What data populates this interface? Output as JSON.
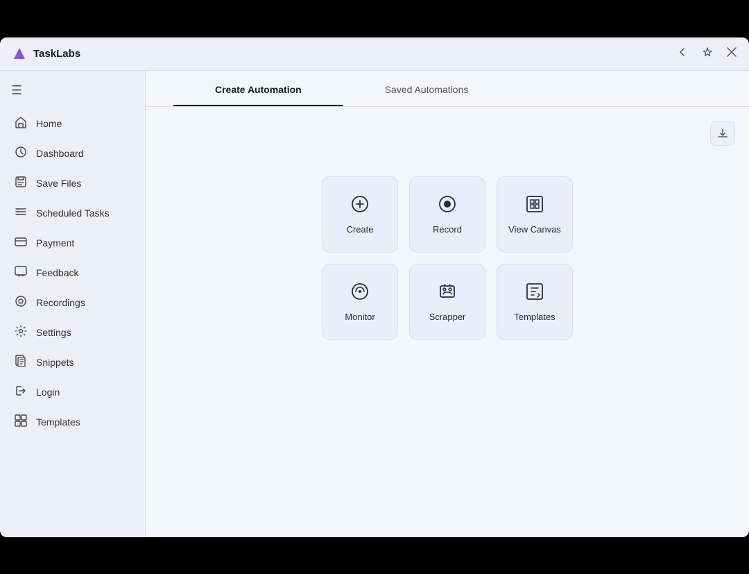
{
  "app": {
    "title": "TaskLabs",
    "logo_color": "#6c3fc5"
  },
  "titlebar": {
    "back_label": "↩",
    "pin_label": "⊳",
    "close_label": "✕"
  },
  "sidebar": {
    "menu_icon": "☰",
    "items": [
      {
        "id": "home",
        "label": "Home",
        "icon": "home"
      },
      {
        "id": "dashboard",
        "label": "Dashboard",
        "icon": "dashboard"
      },
      {
        "id": "save-files",
        "label": "Save Files",
        "icon": "save-files"
      },
      {
        "id": "scheduled-tasks",
        "label": "Scheduled Tasks",
        "icon": "scheduled-tasks"
      },
      {
        "id": "payment",
        "label": "Payment",
        "icon": "payment"
      },
      {
        "id": "feedback",
        "label": "Feedback",
        "icon": "feedback"
      },
      {
        "id": "recordings",
        "label": "Recordings",
        "icon": "recordings"
      },
      {
        "id": "settings",
        "label": "Settings",
        "icon": "settings"
      },
      {
        "id": "snippets",
        "label": "Snippets",
        "icon": "snippets"
      },
      {
        "id": "login",
        "label": "Login",
        "icon": "login"
      },
      {
        "id": "templates",
        "label": "Templates",
        "icon": "templates"
      }
    ]
  },
  "tabs": [
    {
      "id": "create-automation",
      "label": "Create Automation",
      "active": true
    },
    {
      "id": "saved-automations",
      "label": "Saved Automations",
      "active": false
    }
  ],
  "actions": {
    "row1": [
      {
        "id": "create",
        "label": "Create",
        "icon": "create"
      },
      {
        "id": "record",
        "label": "Record",
        "icon": "record"
      },
      {
        "id": "view-canvas",
        "label": "View Canvas",
        "icon": "view-canvas"
      }
    ],
    "row2": [
      {
        "id": "monitor",
        "label": "Monitor",
        "icon": "monitor"
      },
      {
        "id": "scrapper",
        "label": "Scrapper",
        "icon": "scrapper"
      },
      {
        "id": "templates",
        "label": "Templates",
        "icon": "templates"
      }
    ]
  },
  "download_title": "Download"
}
